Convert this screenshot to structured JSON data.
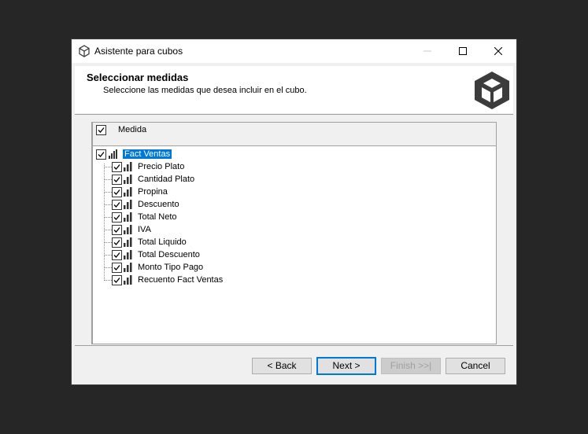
{
  "window": {
    "title": "Asistente para cubos"
  },
  "header": {
    "title": "Seleccionar medidas",
    "subtitle": "Seleccione las medidas que desea incluir en el cubo."
  },
  "list": {
    "column_header": "Medida",
    "column_checked": true,
    "root": {
      "label": "Fact Ventas",
      "checked": true,
      "selected": true
    },
    "items": [
      {
        "label": "Precio Plato",
        "checked": true
      },
      {
        "label": "Cantidad Plato",
        "checked": true
      },
      {
        "label": "Propina",
        "checked": true
      },
      {
        "label": "Descuento",
        "checked": true
      },
      {
        "label": "Total Neto",
        "checked": true
      },
      {
        "label": "IVA",
        "checked": true
      },
      {
        "label": "Total Liquido",
        "checked": true
      },
      {
        "label": "Total Descuento",
        "checked": true
      },
      {
        "label": "Monto Tipo Pago",
        "checked": true
      },
      {
        "label": "Recuento Fact Ventas",
        "checked": true
      }
    ]
  },
  "buttons": {
    "back": "< Back",
    "next": "Next >",
    "finish": "Finish >>|",
    "cancel": "Cancel"
  }
}
